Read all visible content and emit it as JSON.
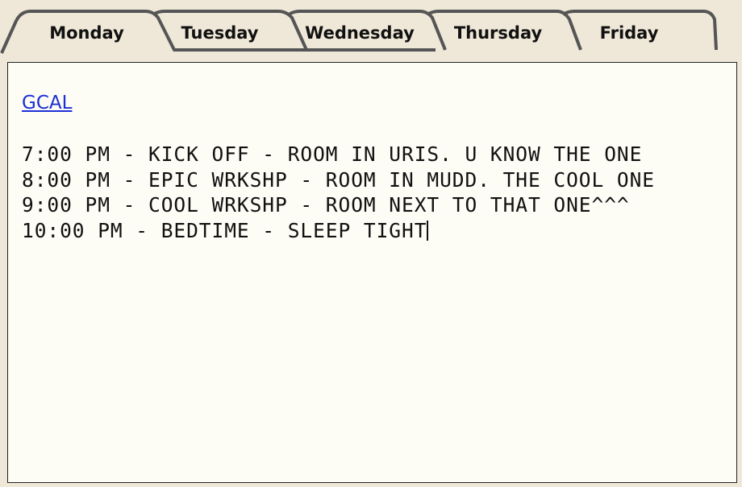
{
  "tabs": [
    {
      "label": "Monday",
      "active": true
    },
    {
      "label": "Tuesday",
      "active": false
    },
    {
      "label": "Wednesday",
      "active": false
    },
    {
      "label": "Thursday",
      "active": false
    },
    {
      "label": "Friday",
      "active": false
    }
  ],
  "content": {
    "link": "GCAL",
    "events": [
      "7:00 PM - KICK OFF - ROOM IN URIS. U KNOW THE ONE",
      "8:00 PM - EPIC WRKSHP - ROOM IN MUDD. THE COOL ONE",
      "9:00 PM - COOL WRKSHP - ROOM NEXT TO THAT ONE^^^",
      "10:00 PM - BEDTIME - SLEEP TIGHT"
    ]
  },
  "colors": {
    "background": "#efe8d8",
    "panel": "#fdfcf5",
    "link": "#1a2fd6",
    "tab_outline": "#555555"
  }
}
